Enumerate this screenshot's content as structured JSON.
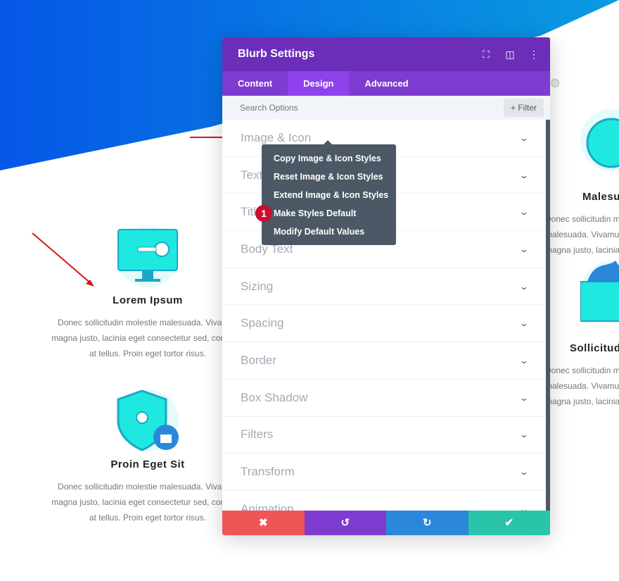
{
  "panel": {
    "title": "Blurb Settings",
    "tabs": [
      {
        "label": "Content"
      },
      {
        "label": "Design"
      },
      {
        "label": "Advanced"
      }
    ],
    "search_placeholder": "Search Options",
    "filter_label": "+ Filter",
    "sections": [
      {
        "label": "Image & Icon"
      },
      {
        "label": "Text"
      },
      {
        "label": "Title Text"
      },
      {
        "label": "Body Text"
      },
      {
        "label": "Sizing"
      },
      {
        "label": "Spacing"
      },
      {
        "label": "Border"
      },
      {
        "label": "Box Shadow"
      },
      {
        "label": "Filters"
      },
      {
        "label": "Transform"
      },
      {
        "label": "Animation"
      }
    ]
  },
  "context_menu": {
    "items": [
      {
        "label": "Copy Image & Icon Styles"
      },
      {
        "label": "Reset Image & Icon Styles"
      },
      {
        "label": "Extend Image & Icon Styles"
      },
      {
        "label": "Make Styles Default"
      },
      {
        "label": "Modify Default Values"
      }
    ],
    "badge": "1"
  },
  "footer": {
    "cancel": "✖",
    "undo": "↺",
    "redo": "↻",
    "save": "✔"
  },
  "blurbs_left": [
    {
      "title": "Lorem Ipsum",
      "text": "Donec sollicitudin molestie malesuada. Vivamus magna justo, lacinia eget consectetur sed, convallis at tellus. Proin eget tortor risus."
    },
    {
      "title": "Proin Eget Sit",
      "text": "Donec sollicitudin molestie malesuada. Vivamus magna justo, lacinia eget consectetur sed, convallis at tellus. Proin eget tortor risus."
    }
  ],
  "blurbs_right": [
    {
      "title": "Malesuada",
      "text": "Donec sollicitudin molestie malesuada. Vivamus magna justo, lacinia eget"
    },
    {
      "title": "Sollicitudin",
      "text": "Donec sollicitudin molestie malesuada. Vivamus magna justo, lacinia eget"
    }
  ],
  "colors": {
    "header": "#6c2eb9",
    "tabs": "#7e3bd0",
    "cancel": "#ef5555",
    "undo": "#7e3bd0",
    "redo": "#2b87da",
    "save": "#29c4a9",
    "icon": "#1ee8e0"
  }
}
